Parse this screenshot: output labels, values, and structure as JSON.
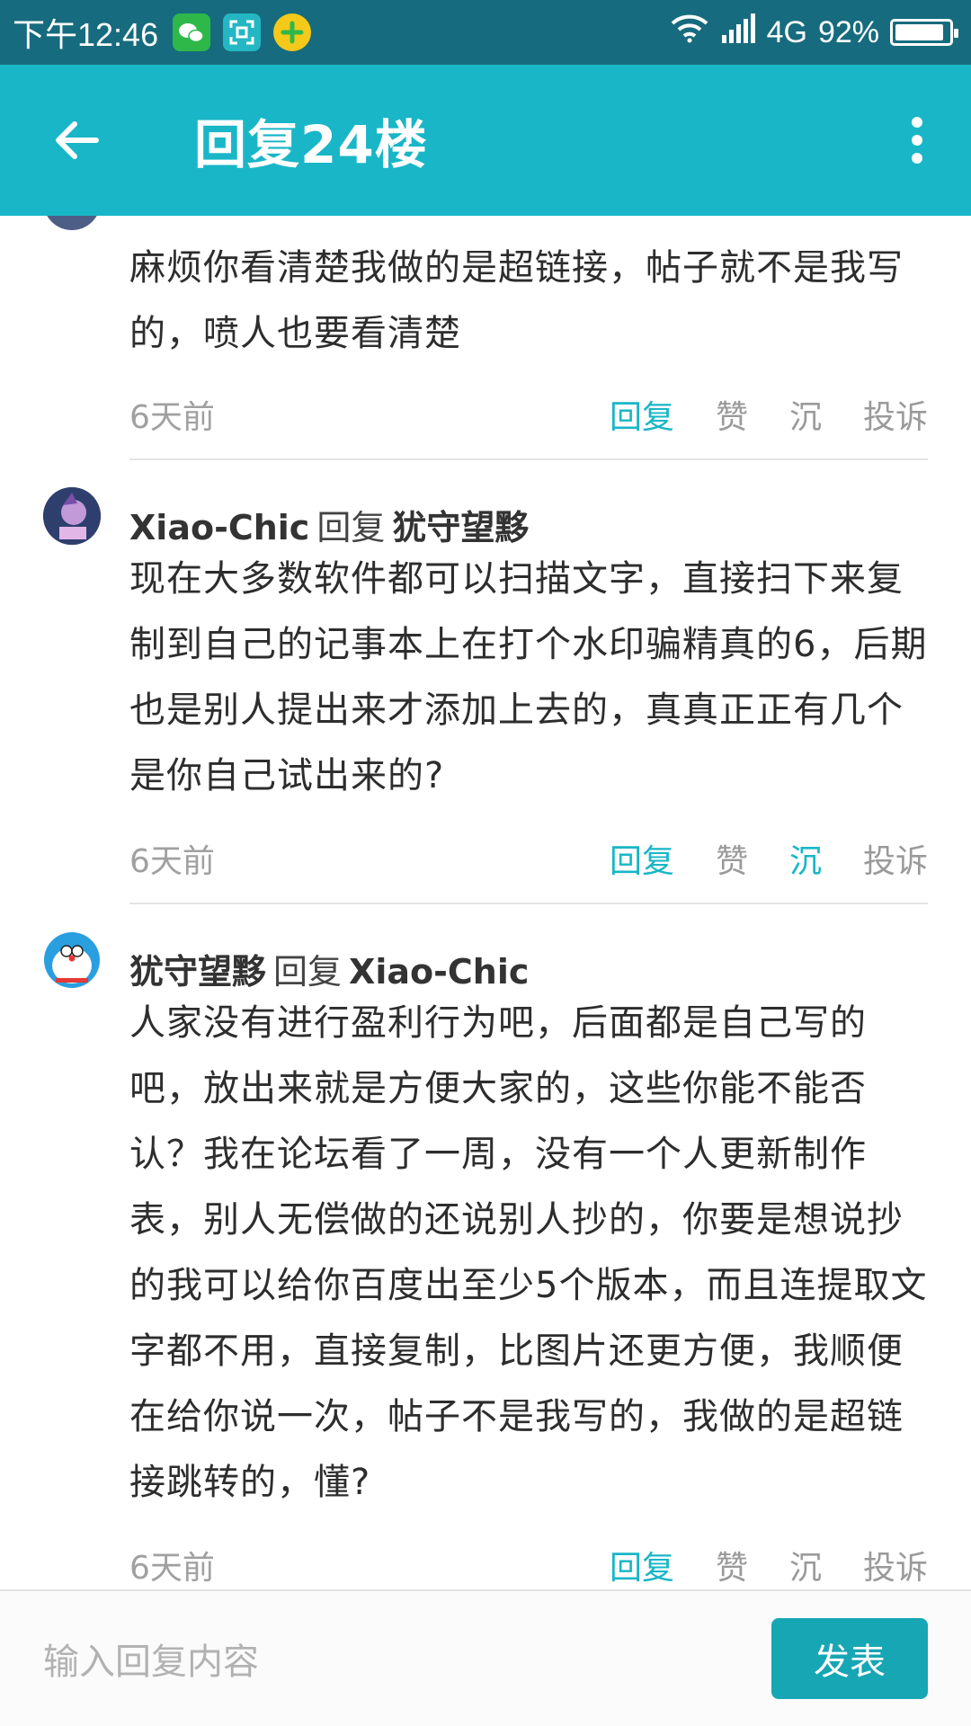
{
  "status_bar": {
    "time": "下午12:46",
    "network": "4G",
    "battery_text": "92%",
    "battery_level": 0.92
  },
  "app_bar": {
    "title": "回复24楼",
    "back_icon": "back-arrow-icon",
    "more_icon": "more-vertical-icon"
  },
  "posts": [
    {
      "author": "",
      "reply_word": "",
      "reply_to": "",
      "text": "麻烦你看清楚我做的是超链接，帖子就不是我写的，喷人也要看清楚",
      "time": "6天前",
      "actions": {
        "reply": "回复",
        "like": "赞",
        "sink": "沉",
        "report": "投诉"
      },
      "reply_active": true,
      "sink_active": false
    },
    {
      "author": "Xiao-Chic",
      "reply_word": "回复",
      "reply_to": "犹守望黟",
      "text": "现在大多数软件都可以扫描文字，直接扫下来复制到自己的记事本上在打个水印骗精真的6，后期也是别人提出来才添加上去的，真真正正有几个是你自己试出来的?",
      "time": "6天前",
      "actions": {
        "reply": "回复",
        "like": "赞",
        "sink": "沉",
        "report": "投诉"
      },
      "reply_active": true,
      "sink_active": true
    },
    {
      "author": "犹守望黟",
      "reply_word": "回复",
      "reply_to": "Xiao-Chic",
      "text": "人家没有进行盈利行为吧，后面都是自己写的吧，放出来就是方便大家的，这些你能不能否认？我在论坛看了一周，没有一个人更新制作表，别人无偿做的还说别人抄的，你要是想说抄的我可以给你百度出至少5个版本，而且连提取文字都不用，直接复制，比图片还更方便，我顺便在给你说一次，帖子不是我写的，我做的是超链接跳转的，懂?",
      "time": "6天前",
      "actions": {
        "reply": "回复",
        "like": "赞",
        "sink": "沉",
        "report": "投诉"
      },
      "reply_active": true,
      "sink_active": false
    }
  ],
  "reply_bar": {
    "placeholder": "输入回复内容",
    "send_label": "发表"
  },
  "colors": {
    "status_bar_bg": "#176b7e",
    "app_bar_bg": "#19b6c7",
    "accent": "#19b6c7",
    "send_button_bg": "#17a6b4"
  }
}
